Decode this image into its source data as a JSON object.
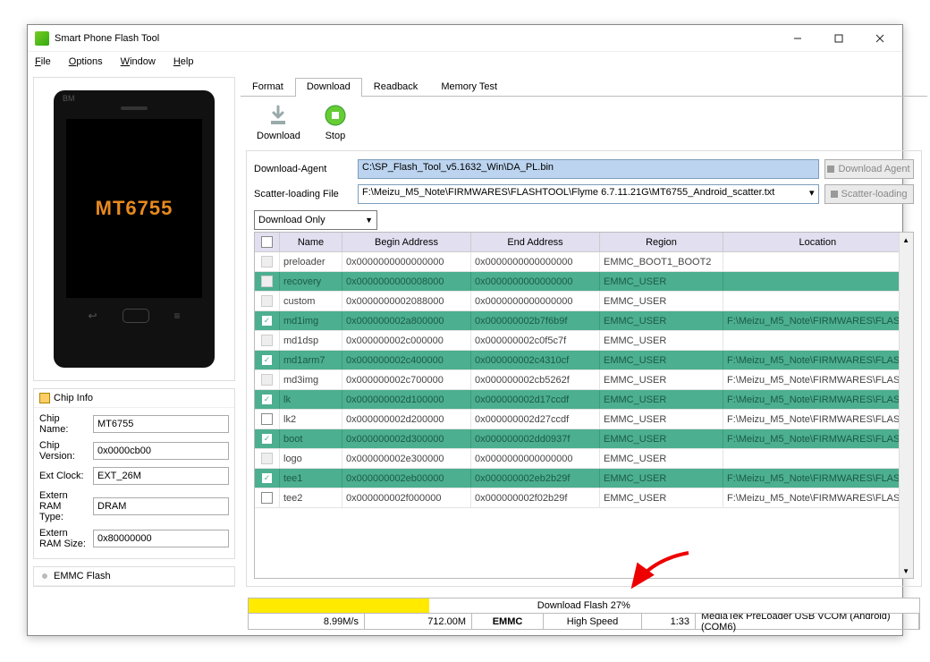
{
  "window": {
    "title": "Smart Phone Flash Tool"
  },
  "menu": {
    "file": "File",
    "options": "Options",
    "window": "Window",
    "help": "Help"
  },
  "phone": {
    "brand": "BM",
    "chip": "MT6755"
  },
  "chipinfo": {
    "title": "Chip Info",
    "name_lbl": "Chip Name:",
    "name_val": "MT6755",
    "ver_lbl": "Chip Version:",
    "ver_val": "0x0000cb00",
    "clk_lbl": "Ext Clock:",
    "clk_val": "EXT_26M",
    "ramt_lbl": "Extern RAM Type:",
    "ramt_val": "DRAM",
    "rams_lbl": "Extern RAM Size:",
    "rams_val": "0x80000000"
  },
  "emmc": {
    "title": "EMMC Flash"
  },
  "tabs": {
    "format": "Format",
    "download": "Download",
    "readback": "Readback",
    "memtest": "Memory Test"
  },
  "toolbar": {
    "download": "Download",
    "stop": "Stop"
  },
  "form": {
    "da_lbl": "Download-Agent",
    "da_val": "C:\\SP_Flash_Tool_v5.1632_Win\\DA_PL.bin",
    "da_btn": "Download Agent",
    "scatter_lbl": "Scatter-loading File",
    "scatter_val": "F:\\Meizu_M5_Note\\FIRMWARES\\FLASHTOOL\\Flyme 6.7.11.21G\\MT6755_Android_scatter.txt",
    "scatter_btn": "Scatter-loading",
    "mode": "Download Only"
  },
  "grid": {
    "head": {
      "chk": "",
      "name": "Name",
      "begin": "Begin Address",
      "end": "End Address",
      "region": "Region",
      "location": "Location"
    },
    "rows": [
      {
        "green": false,
        "chk": false,
        "name": "preloader",
        "ba": "0x0000000000000000",
        "ea": "0x0000000000000000",
        "rg": "EMMC_BOOT1_BOOT2",
        "lc": ""
      },
      {
        "green": true,
        "chk": false,
        "name": "recovery",
        "ba": "0x0000000000008000",
        "ea": "0x0000000000000000",
        "rg": "EMMC_USER",
        "lc": ""
      },
      {
        "green": false,
        "chk": false,
        "name": "custom",
        "ba": "0x0000000002088000",
        "ea": "0x0000000000000000",
        "rg": "EMMC_USER",
        "lc": ""
      },
      {
        "green": true,
        "chk": true,
        "name": "md1img",
        "ba": "0x000000002a800000",
        "ea": "0x000000002b7f6b9f",
        "rg": "EMMC_USER",
        "lc": "F:\\Meizu_M5_Note\\FIRMWARES\\FLAS..."
      },
      {
        "green": false,
        "chk": false,
        "name": "md1dsp",
        "ba": "0x000000002c000000",
        "ea": "0x000000002c0f5c7f",
        "rg": "EMMC_USER",
        "lc": ""
      },
      {
        "green": true,
        "chk": true,
        "name": "md1arm7",
        "ba": "0x000000002c400000",
        "ea": "0x000000002c4310cf",
        "rg": "EMMC_USER",
        "lc": "F:\\Meizu_M5_Note\\FIRMWARES\\FLAS..."
      },
      {
        "green": false,
        "chk": false,
        "name": "md3img",
        "ba": "0x000000002c700000",
        "ea": "0x000000002cb5262f",
        "rg": "EMMC_USER",
        "lc": "F:\\Meizu_M5_Note\\FIRMWARES\\FLAS..."
      },
      {
        "green": true,
        "chk": true,
        "name": "lk",
        "ba": "0x000000002d100000",
        "ea": "0x000000002d17ccdf",
        "rg": "EMMC_USER",
        "lc": "F:\\Meizu_M5_Note\\FIRMWARES\\FLAS..."
      },
      {
        "green": false,
        "chk": true,
        "name": "lk2",
        "ba": "0x000000002d200000",
        "ea": "0x000000002d27ccdf",
        "rg": "EMMC_USER",
        "lc": "F:\\Meizu_M5_Note\\FIRMWARES\\FLAS..."
      },
      {
        "green": true,
        "chk": true,
        "name": "boot",
        "ba": "0x000000002d300000",
        "ea": "0x000000002dd0937f",
        "rg": "EMMC_USER",
        "lc": "F:\\Meizu_M5_Note\\FIRMWARES\\FLAS..."
      },
      {
        "green": false,
        "chk": false,
        "name": "logo",
        "ba": "0x000000002e300000",
        "ea": "0x0000000000000000",
        "rg": "EMMC_USER",
        "lc": ""
      },
      {
        "green": true,
        "chk": true,
        "name": "tee1",
        "ba": "0x000000002eb00000",
        "ea": "0x000000002eb2b29f",
        "rg": "EMMC_USER",
        "lc": "F:\\Meizu_M5_Note\\FIRMWARES\\FLAS..."
      },
      {
        "green": false,
        "chk": true,
        "name": "tee2",
        "ba": "0x000000002f000000",
        "ea": "0x000000002f02b29f",
        "rg": "EMMC_USER",
        "lc": "F:\\Meizu_M5_Note\\FIRMWARES\\FLAS..."
      }
    ]
  },
  "progress": {
    "label": "Download Flash 27%",
    "percent": 27
  },
  "status": {
    "speed": "8.99M/s",
    "size": "712.00M",
    "storage": "EMMC",
    "usbmode": "High Speed",
    "time": "1:33",
    "device": "MediaTek PreLoader USB VCOM (Android) (COM6)"
  }
}
